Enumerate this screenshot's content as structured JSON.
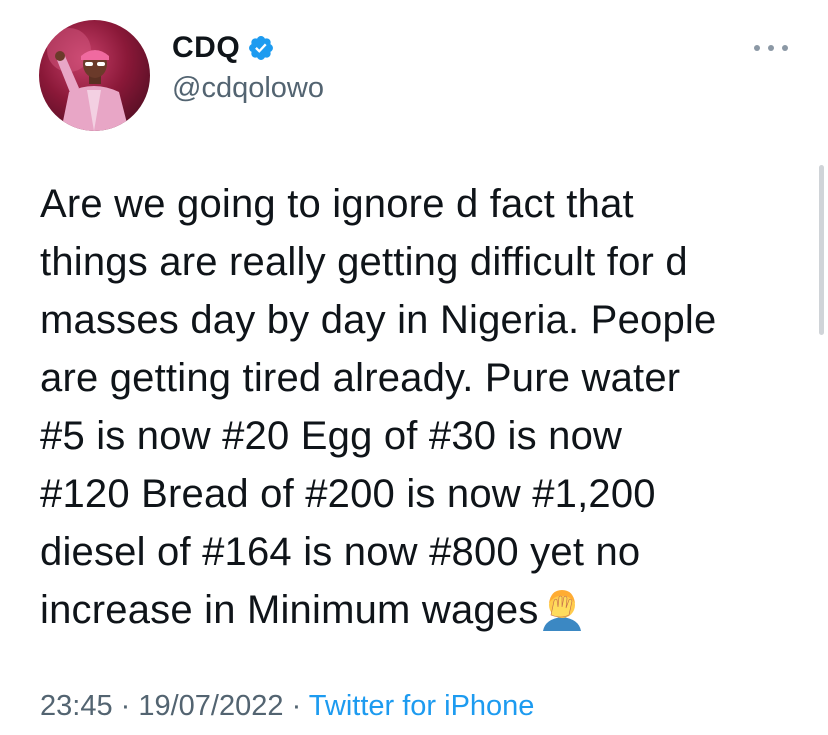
{
  "author": {
    "display_name": "CDQ",
    "handle": "@cdqolowo",
    "verified": true,
    "avatar_icon": "user-avatar"
  },
  "tweet": {
    "lines": [
      "Are we going to ignore d fact that",
      "things are really getting difficult for d",
      "masses day by day in Nigeria. People",
      "are getting tired already. Pure water",
      "#5 is now #20 Egg of #30 is now",
      "#120 Bread of #200 is now #1,200",
      "diesel of #164 is now #800 yet no",
      "increase in Minimum wages"
    ],
    "emoji": "🤦‍♂️"
  },
  "meta": {
    "time": "23:45",
    "separator1": " · ",
    "date": "19/07/2022",
    "separator2": " · ",
    "source": "Twitter for iPhone"
  },
  "colors": {
    "verified": "#1d9bf0",
    "link": "#1d9bf0",
    "secondary_text": "#536471"
  }
}
